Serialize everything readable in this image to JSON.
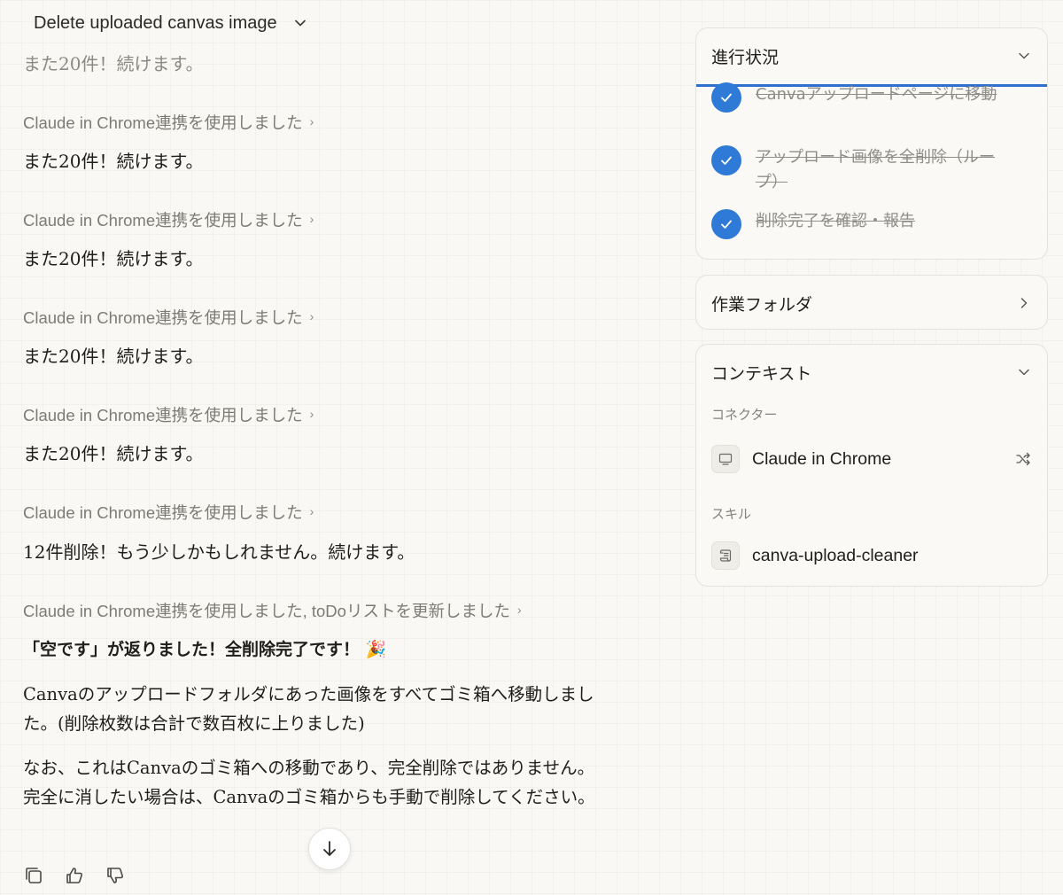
{
  "header": {
    "title": "Delete uploaded canvas image"
  },
  "chat": {
    "faded_top": "また20件！続けます。",
    "tool_label": "Claude in Chrome連携を使用しました",
    "repeat_msg": "また20件！続けます。",
    "msg_12": "12件削除！もう少しかもしれません。続けます。",
    "tool_label_final": "Claude in Chrome連携を使用しました, toDoリストを更新しました",
    "done_heading": "「空です」が返りました！全削除完了です！",
    "party_emoji": "🎉",
    "para1": "Canvaのアップロードフォルダにあった画像をすべてゴミ箱へ移動しました。(削除枚数は合計で数百枚に上りました)",
    "para2": "なお、これはCanvaのゴミ箱への移動であり、完全削除ではありません。完全に消したい場合は、Canvaのゴミ箱からも手動で削除してください。"
  },
  "actions": {
    "icons": [
      "copy-icon",
      "thumbs-up-icon",
      "thumbs-down-icon",
      "arrow-down-icon"
    ]
  },
  "progress": {
    "title": "進行状況",
    "items": [
      {
        "text": "Canvaアップロードページに移動",
        "done": true
      },
      {
        "text": "アップロード画像を全削除（ループ）",
        "done": true
      },
      {
        "text": "削除完了を確認・報告",
        "done": true
      }
    ],
    "accent": "#2e7ad6"
  },
  "folder": {
    "title": "作業フォルダ"
  },
  "context": {
    "title": "コンテキスト",
    "connectors_label": "コネクター",
    "connector": "Claude in Chrome",
    "skills_label": "スキル",
    "skill": "canva-upload-cleaner"
  }
}
